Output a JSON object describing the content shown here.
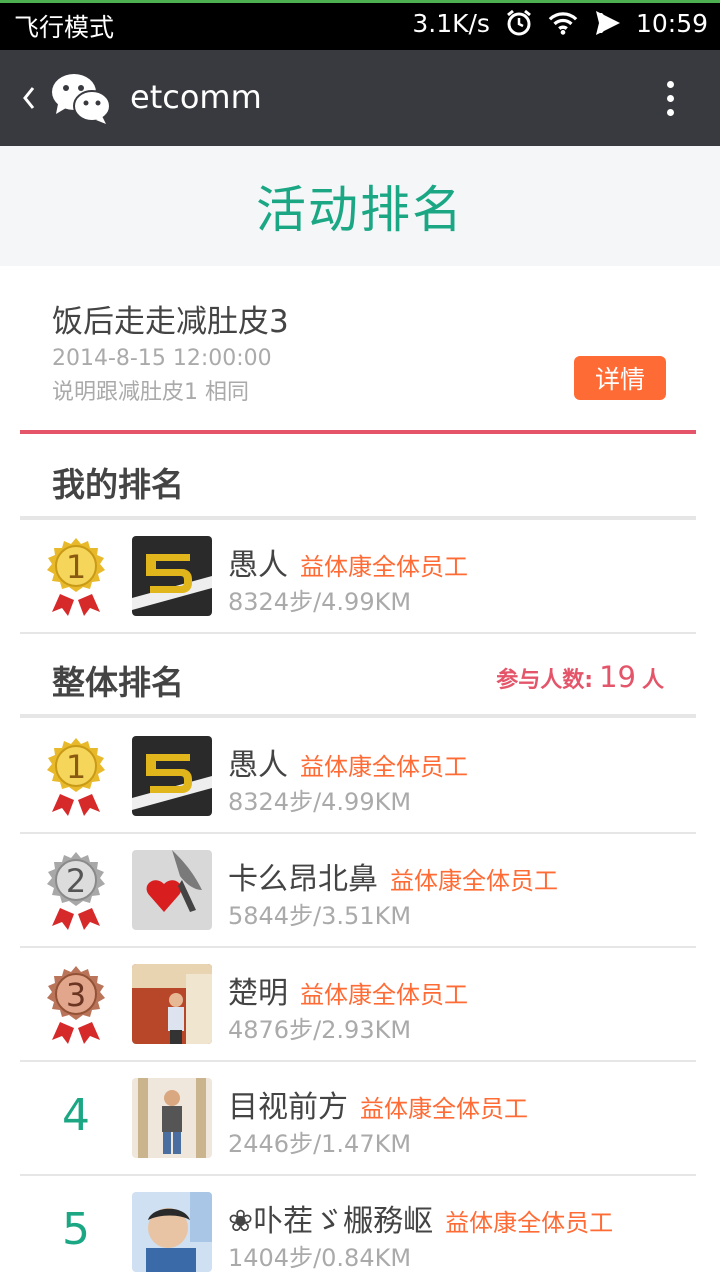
{
  "status_bar": {
    "mode": "飞行模式",
    "speed": "3.1K/s",
    "time": "10:59",
    "icons": [
      "alarm-icon",
      "wifi-icon",
      "airplane-icon"
    ]
  },
  "title_bar": {
    "title": "etcomm",
    "icons": [
      "back-chevron-icon",
      "wechat-logo-icon",
      "more-vertical-icon"
    ]
  },
  "page": {
    "title": "活动排名"
  },
  "activity": {
    "name": "饭后走走减肚皮3",
    "date": "2014-8-15 12:00:00",
    "description": "说明跟减肚皮1 相同",
    "detail_button": "详情"
  },
  "my_rank": {
    "title": "我的排名",
    "entry": {
      "rank": 1,
      "name": "愚人",
      "group": "益体康全体员工",
      "steps": "8324步/4.99KM"
    }
  },
  "overall_rank": {
    "title": "整体排名",
    "participants_label": "参与人数:",
    "participants_count": "19",
    "participants_unit": "人",
    "entries": [
      {
        "rank": "1",
        "name": "愚人",
        "group": "益体康全体员工",
        "steps": "8324步/4.99KM"
      },
      {
        "rank": "2",
        "name": "卡么昂北鼻",
        "group": "益体康全体员工",
        "steps": "5844步/3.51KM"
      },
      {
        "rank": "3",
        "name": "楚明",
        "group": "益体康全体员工",
        "steps": "4876步/2.93KM"
      },
      {
        "rank": "4",
        "name": "目视前方",
        "group": "益体康全体员工",
        "steps": "2446步/1.47KM"
      },
      {
        "rank": "5",
        "name": "❀卟茬ゞ棴務岖",
        "group": "益体康全体员工",
        "steps": "1404步/0.84KM"
      }
    ]
  },
  "colors": {
    "accent_green": "#1ba784",
    "accent_red": "#e4556a",
    "button_orange": "#ff6b35",
    "title_bar": "#393a3f",
    "gold": "#e8b92a",
    "silver": "#b8b8b8",
    "bronze": "#c07a5a"
  }
}
